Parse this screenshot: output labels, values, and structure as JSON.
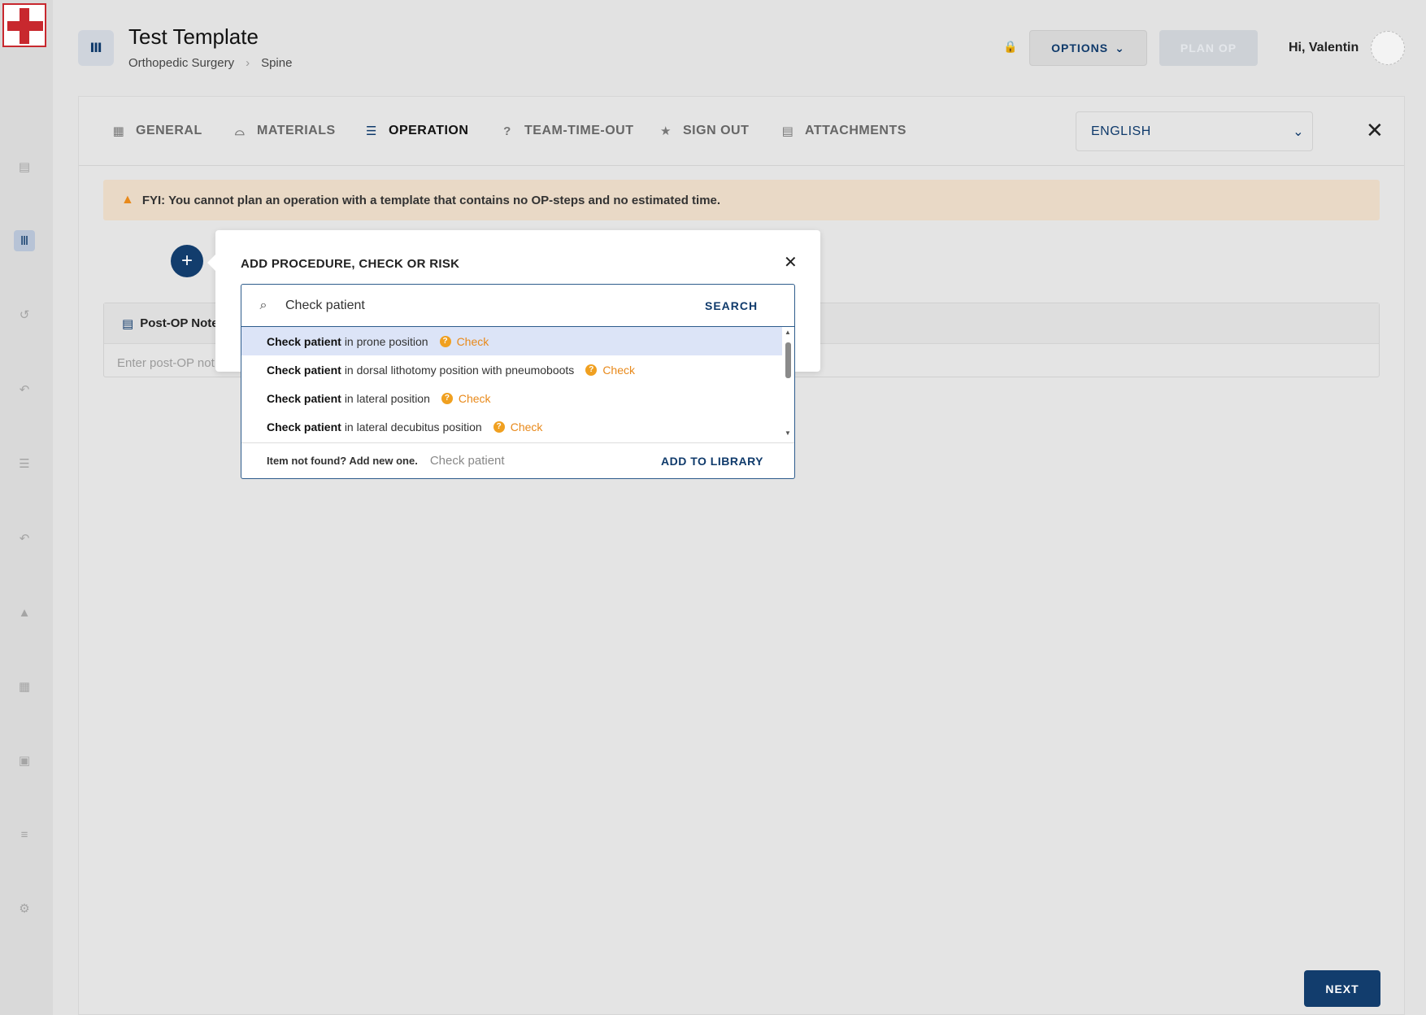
{
  "header": {
    "title": "Test Template",
    "breadcrumb": [
      "Orthopedic Surgery",
      "Spine"
    ],
    "options_label": "OPTIONS",
    "plan_op_label": "PLAN OP",
    "greeting": "Hi, Valentin",
    "title_icon": "library-icon",
    "lock_icon": "lock-icon"
  },
  "sidebar": {
    "items": [
      {
        "icon": "dashboard-icon"
      },
      {
        "icon": "library-icon",
        "active": true
      },
      {
        "icon": "history-icon"
      },
      {
        "icon": "restore-icon"
      },
      {
        "icon": "checklist-icon"
      },
      {
        "icon": "undo-icon"
      },
      {
        "icon": "warning-icon"
      },
      {
        "icon": "chart-icon"
      },
      {
        "icon": "report-icon"
      },
      {
        "icon": "search-list-icon"
      },
      {
        "icon": "settings-icon"
      }
    ]
  },
  "tabs": [
    {
      "label": "GENERAL",
      "icon": "building-icon"
    },
    {
      "label": "MATERIALS",
      "icon": "tray-icon"
    },
    {
      "label": "OPERATION",
      "icon": "list-icon",
      "active": true
    },
    {
      "label": "TEAM-TIME-OUT",
      "icon": "question-icon"
    },
    {
      "label": "SIGN OUT",
      "icon": "star-icon"
    },
    {
      "label": "ATTACHMENTS",
      "icon": "file-icon"
    }
  ],
  "language": {
    "selected": "ENGLISH"
  },
  "fyi": {
    "text": "FYI: You cannot plan an operation with a template that contains no OP-steps and no estimated time."
  },
  "notes": {
    "title": "Post-OP Note",
    "placeholder": "Enter post-OP not"
  },
  "popup": {
    "title": "ADD PROCEDURE, CHECK OR RISK",
    "search_value": "Check patient",
    "search_label": "SEARCH",
    "results": [
      {
        "bold": "Check patient",
        "rest": "in prone position",
        "type": "Check"
      },
      {
        "bold": "Check patient",
        "rest": "in dorsal lithotomy position with pneumoboots",
        "type": "Check"
      },
      {
        "bold": "Check patient",
        "rest": "in lateral position",
        "type": "Check"
      },
      {
        "bold": "Check patient",
        "rest": "in lateral decubitus position",
        "type": "Check"
      }
    ],
    "not_found_label": "Item not found? Add new one.",
    "not_found_value": "Check patient",
    "add_to_library_label": "ADD TO LIBRARY"
  },
  "next_label": "NEXT",
  "colors": {
    "primary": "#123d6d",
    "accent": "#e8891a",
    "fyi_bg": "#e9d9c6",
    "highlight": "#dce4f7"
  }
}
